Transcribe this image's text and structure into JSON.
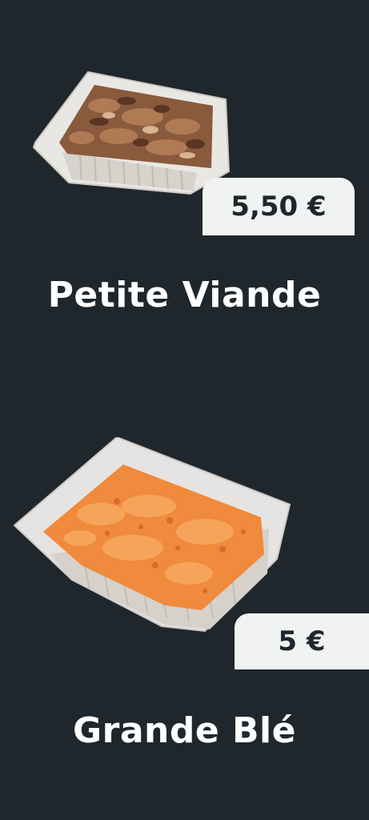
{
  "products": [
    {
      "name": "Petite Viande",
      "price": "5,50 €",
      "image_icon": "meat-tray-icon"
    },
    {
      "name": "Grande Blé",
      "price": "5 €",
      "image_icon": "bulgur-tray-icon"
    }
  ]
}
